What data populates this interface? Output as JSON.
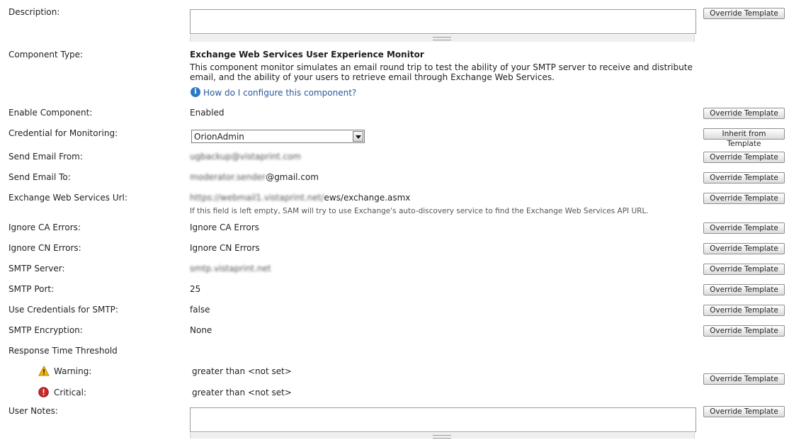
{
  "fields": {
    "description": {
      "label": "Description:",
      "value": ""
    },
    "component_type": {
      "label": "Component Type:",
      "title": "Exchange Web Services User Experience Monitor",
      "description": "This component monitor simulates an email round trip to test the ability of your SMTP server to receive and distribute email, and the ability of your users to retrieve email through Exchange Web Services.",
      "help_link": "How do I configure this component?"
    },
    "enable_component": {
      "label": "Enable Component:",
      "value": "Enabled"
    },
    "credential": {
      "label": "Credential for Monitoring:",
      "value": "OrionAdmin"
    },
    "send_from": {
      "label": "Send Email From:",
      "value": "ugbackup@vistaprint.com"
    },
    "send_to": {
      "label": "Send Email To:",
      "value_hidden": "moderator.sender",
      "value_visible": "@gmail.com"
    },
    "ews_url": {
      "label": "Exchange Web Services Url:",
      "value_hidden": "https://webmail1.vistaprint.net/",
      "value_visible": "ews/exchange.asmx",
      "hint": "If this field is left empty, SAM will try to use Exchange's auto-discovery service to find the Exchange Web Services API URL."
    },
    "ignore_ca": {
      "label": "Ignore CA Errors:",
      "value": "Ignore CA Errors"
    },
    "ignore_cn": {
      "label": "Ignore CN Errors:",
      "value": "Ignore CN Errors"
    },
    "smtp_server": {
      "label": "SMTP Server:",
      "value": "smtp.vistaprint.net"
    },
    "smtp_port": {
      "label": "SMTP Port:",
      "value": "25"
    },
    "use_credentials": {
      "label": "Use Credentials for SMTP:",
      "value": "false"
    },
    "smtp_encryption": {
      "label": "SMTP Encryption:",
      "value": "None"
    },
    "response_threshold": {
      "label": "Response Time Threshold",
      "warning_label": "Warning:",
      "warning_value": "greater than <not set>",
      "critical_label": "Critical:",
      "critical_value": "greater than <not set>"
    },
    "user_notes": {
      "label": "User Notes:",
      "value": ""
    }
  },
  "buttons": {
    "override": "Override Template",
    "inherit": "Inherit from Template"
  },
  "icons": {
    "info": "info-icon",
    "warning": "warning-icon",
    "critical": "critical-icon"
  },
  "colors": {
    "link": "#2a5a9a",
    "warning": "#f2b418",
    "critical": "#c62a2a",
    "info": "#2b78c5"
  }
}
